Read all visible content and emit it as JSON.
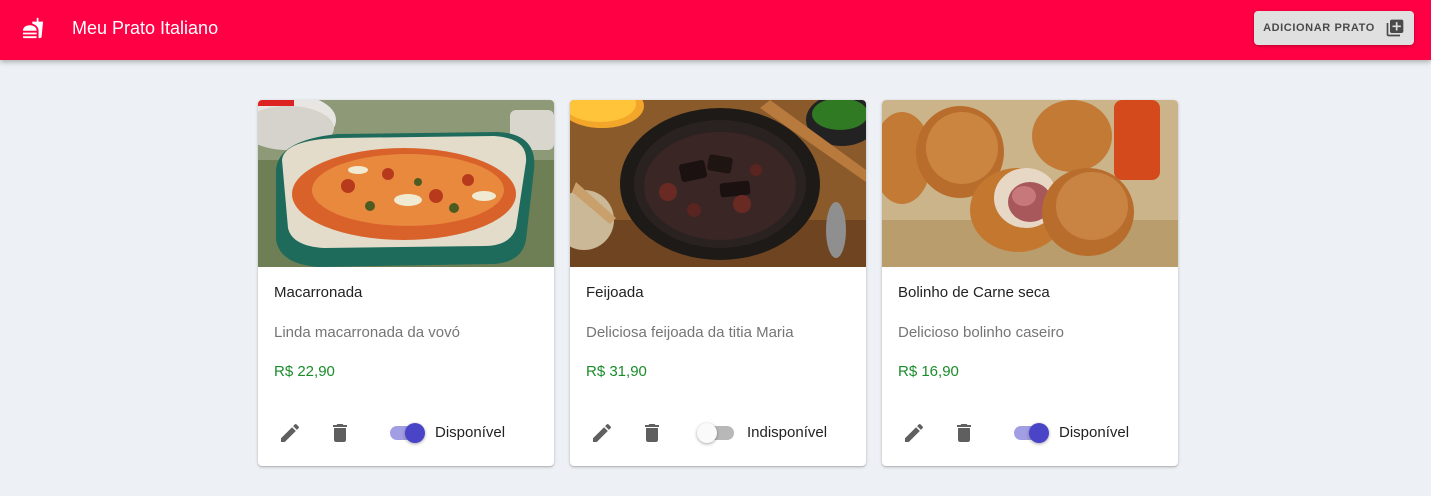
{
  "header": {
    "title": "Meu Prato Italiano",
    "add_button_label": "Adicionar Prato"
  },
  "colors": {
    "appbar": "#ff0044",
    "price": "#1a8c2b",
    "switch_on": "#4a44c6"
  },
  "dishes": [
    {
      "name": "Macarronada",
      "description": "Linda macarronada da vovó",
      "price": "R$ 22,90",
      "status": "Disponível",
      "available": true
    },
    {
      "name": "Feijoada",
      "description": "Deliciosa feijoada da titia Maria",
      "price": "R$ 31,90",
      "status": "Indisponível",
      "available": false
    },
    {
      "name": "Bolinho de Carne seca",
      "description": "Delicioso bolinho caseiro",
      "price": "R$ 16,90",
      "status": "Disponível",
      "available": true
    }
  ]
}
